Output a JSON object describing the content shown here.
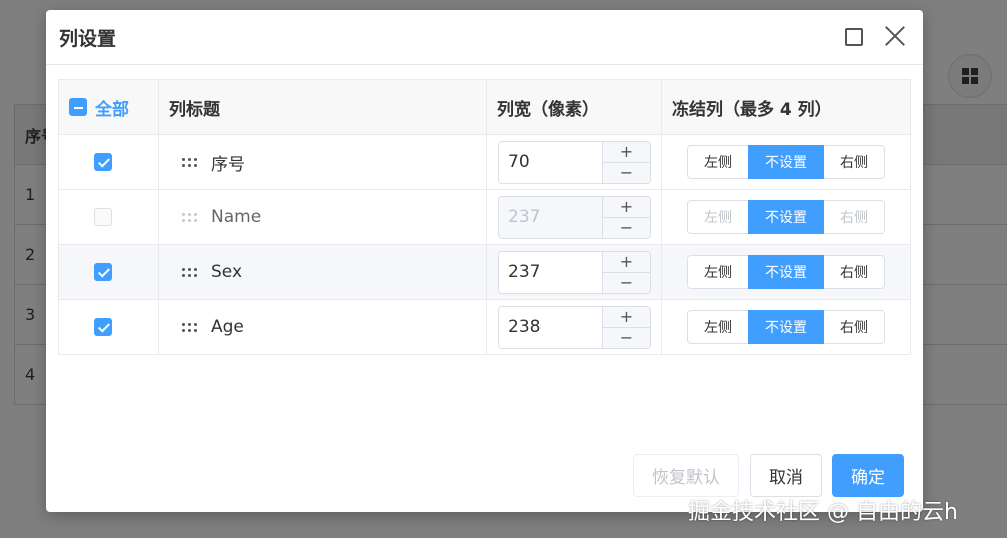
{
  "dialog": {
    "title": "列设置",
    "headers": {
      "all_label": "全部",
      "title_col": "列标题",
      "width_col": "列宽（像素）",
      "freeze_col": "冻结列（最多 4 列）"
    },
    "rows": [
      {
        "checked": true,
        "label": "序号",
        "width": "70",
        "disabled": false
      },
      {
        "checked": false,
        "label": "Name",
        "width": "237",
        "disabled": true
      },
      {
        "checked": true,
        "label": "Sex",
        "width": "237",
        "disabled": false
      },
      {
        "checked": true,
        "label": "Age",
        "width": "238",
        "disabled": false
      }
    ],
    "freeze_options": {
      "left": "左侧",
      "none": "不设置",
      "right": "右侧"
    },
    "selected_freeze": "不设置",
    "stepper": {
      "plus": "+",
      "minus": "−"
    },
    "footer": {
      "reset": "恢复默认",
      "cancel": "取消",
      "ok": "确定"
    }
  },
  "background": {
    "table_header": "序号",
    "rows": [
      "1",
      "2",
      "3",
      "4"
    ]
  },
  "watermark": "掘金技术社区 @ 自由的云h",
  "colors": {
    "accent": "#409eff",
    "overlay": "#7f7f7f"
  },
  "icons": [
    "maximize-icon",
    "close-icon",
    "drag-handle-icon",
    "grid-icon",
    "checkbox-icon"
  ]
}
